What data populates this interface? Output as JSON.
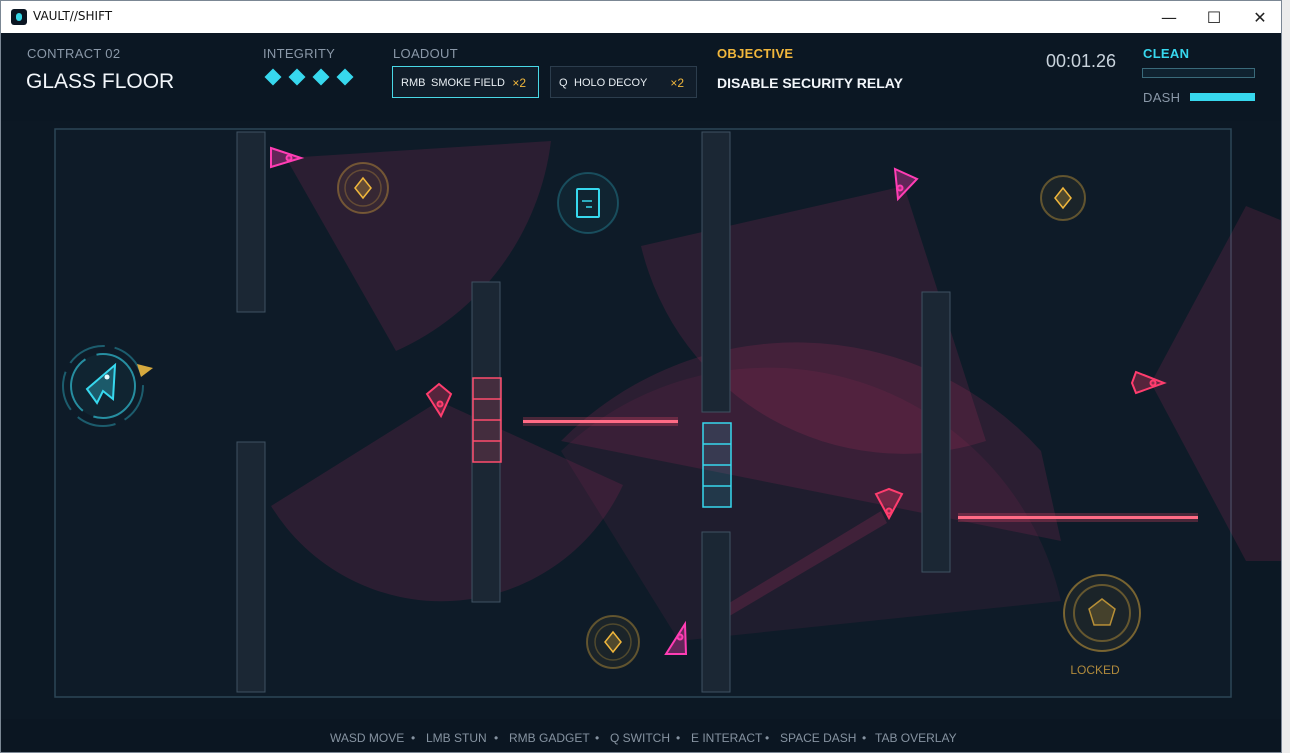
{
  "window": {
    "title": "VAULT//SHIFT",
    "minimize": "—",
    "maximize": "☐",
    "close": "✕"
  },
  "hud": {
    "contract": "CONTRACT 02",
    "level_name": "GLASS FLOOR",
    "integrity_label": "INTEGRITY",
    "integrity_pips": 4,
    "loadout_label": "LOADOUT",
    "loadout": [
      {
        "key": "RMB",
        "name": "SMOKE FIELD",
        "count": "×2",
        "active": true
      },
      {
        "key": "Q",
        "name": "HOLO DECOY",
        "count": "×2",
        "active": false
      }
    ],
    "objective_label": "OBJECTIVE",
    "objective": "DISABLE SECURITY RELAY",
    "timer": "00:01.26",
    "clean_label": "CLEAN",
    "clean_level": 0,
    "dash_label": "DASH",
    "dash_level": 1
  },
  "map": {
    "exit_status": "LOCKED"
  },
  "footer": {
    "hints": [
      "WASD MOVE",
      "LMB STUN",
      "RMB GADGET",
      "Q SWITCH",
      "E INTERACT",
      "SPACE DASH",
      "TAB OVERLAY"
    ],
    "separator": "•"
  },
  "colors": {
    "accent": "#37d8ee",
    "guard": "#ff3d6e",
    "camera": "#ff3db4",
    "loot": "#f1b73c",
    "laser": "#ff4d6d"
  }
}
